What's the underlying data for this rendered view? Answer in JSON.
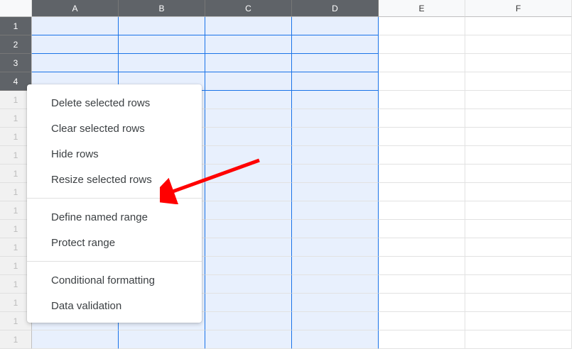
{
  "columns": [
    {
      "label": "A",
      "selected": true
    },
    {
      "label": "B",
      "selected": true
    },
    {
      "label": "C",
      "selected": true
    },
    {
      "label": "D",
      "selected": true
    },
    {
      "label": "E",
      "selected": false
    },
    {
      "label": "F",
      "selected": false
    }
  ],
  "rows": [
    {
      "label": "1",
      "selected": true,
      "obscured": false
    },
    {
      "label": "2",
      "selected": true,
      "obscured": false
    },
    {
      "label": "3",
      "selected": true,
      "obscured": false
    },
    {
      "label": "4",
      "selected": true,
      "obscured": false
    },
    {
      "label": "1",
      "selected": false,
      "obscured": true
    },
    {
      "label": "1",
      "selected": false,
      "obscured": true
    },
    {
      "label": "1",
      "selected": false,
      "obscured": true
    },
    {
      "label": "1",
      "selected": false,
      "obscured": true
    },
    {
      "label": "1",
      "selected": false,
      "obscured": true
    },
    {
      "label": "1",
      "selected": false,
      "obscured": true
    },
    {
      "label": "1",
      "selected": false,
      "obscured": true
    },
    {
      "label": "1",
      "selected": false,
      "obscured": true
    },
    {
      "label": "1",
      "selected": false,
      "obscured": true
    },
    {
      "label": "1",
      "selected": false,
      "obscured": true
    },
    {
      "label": "1",
      "selected": false,
      "obscured": true
    },
    {
      "label": "1",
      "selected": false,
      "obscured": true
    },
    {
      "label": "1",
      "selected": false,
      "obscured": true
    },
    {
      "label": "1",
      "selected": false,
      "obscured": true
    }
  ],
  "context_menu": {
    "items": [
      {
        "label": "Delete selected rows"
      },
      {
        "label": "Clear selected rows"
      },
      {
        "label": "Hide rows"
      },
      {
        "label": "Resize selected rows"
      },
      {
        "type": "separator"
      },
      {
        "label": "Define named range"
      },
      {
        "label": "Protect range"
      },
      {
        "type": "separator"
      },
      {
        "label": "Conditional formatting"
      },
      {
        "label": "Data validation"
      }
    ]
  },
  "annotation": {
    "arrow_color": "#ff0000",
    "points_to": "Resize selected rows"
  }
}
